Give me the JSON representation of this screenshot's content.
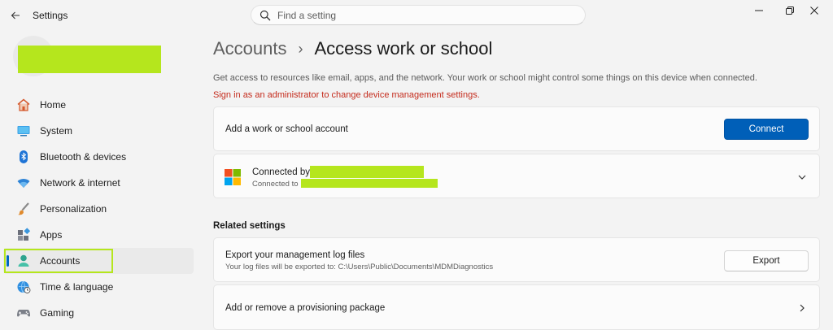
{
  "window": {
    "app_title": "Settings"
  },
  "search": {
    "placeholder": "Find a setting"
  },
  "sidebar": {
    "items": [
      {
        "label": "Home",
        "icon": "home-icon"
      },
      {
        "label": "System",
        "icon": "system-icon"
      },
      {
        "label": "Bluetooth & devices",
        "icon": "bluetooth-icon"
      },
      {
        "label": "Network & internet",
        "icon": "wifi-icon"
      },
      {
        "label": "Personalization",
        "icon": "brush-icon"
      },
      {
        "label": "Apps",
        "icon": "apps-icon"
      },
      {
        "label": "Accounts",
        "icon": "accounts-icon",
        "active": true
      },
      {
        "label": "Time & language",
        "icon": "globe-clock-icon"
      },
      {
        "label": "Gaming",
        "icon": "gamepad-icon"
      }
    ]
  },
  "header": {
    "parent": "Accounts",
    "separator": "›",
    "current": "Access work or school"
  },
  "main": {
    "description": "Get access to resources like email, apps, and the network. Your work or school might control some things on this device when connected.",
    "admin_warning": "Sign in as an administrator to change device management settings.",
    "add_account": {
      "title": "Add a work or school account",
      "button": "Connect"
    },
    "connection": {
      "title": "Connected by",
      "subtitle": "Connected to"
    },
    "related_heading": "Related settings",
    "export_logs": {
      "title": "Export your management log files",
      "subtitle": "Your log files will be exported to: C:\\Users\\Public\\Documents\\MDMDiagnostics",
      "button": "Export"
    },
    "provisioning": {
      "title": "Add or remove a provisioning package"
    }
  },
  "colors": {
    "accent": "#005fb8",
    "warning": "#c42b1c",
    "redaction": "#b5e61d"
  }
}
